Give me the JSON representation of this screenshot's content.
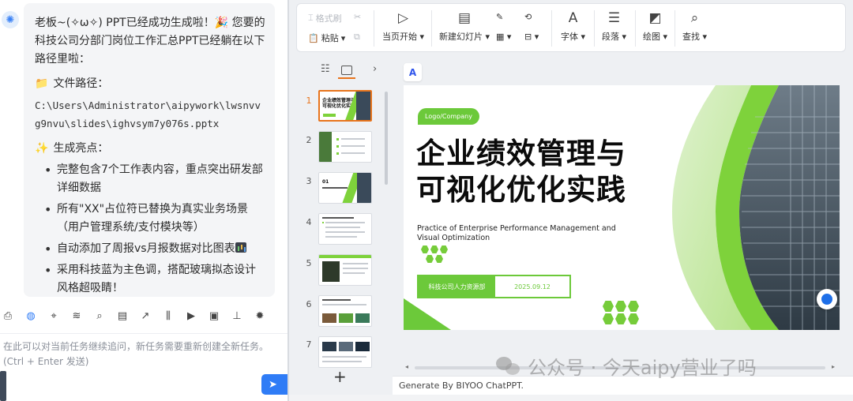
{
  "chat": {
    "greeting": "老板~(✧ω✧) PPT已经成功生成啦！🎉 您要的科技公司分部门岗位工作汇总PPT已经躺在以下路径里啦：",
    "file_path_label": "文件路径：",
    "file_path": "C:\\Users\\Administrator\\aipywork\\lwsnvvg9nvu\\slides\\ighvsym7y076s.pptx",
    "highlights_label": "生成亮点：",
    "highlights": [
      "完整包含7个工作表内容，重点突出研发部详细数据",
      "所有\"XX\"占位符已替换为真实业务场景（用户管理系统/支付模块等）",
      "自动添加了周报vs月报数据对比图表",
      "采用科技蓝为主色调，搭配玻璃拟态设计风格超吸睛！"
    ],
    "input_placeholder_1": "在此可以对当前任务继续追问，新任务需要重新创建全新任务。",
    "input_placeholder_2": "(Ctrl + Enter 发送)",
    "send_label": "发"
  },
  "ribbon": {
    "format_painter": "格式刷",
    "paste": "粘贴",
    "play_from_current": "当页开始",
    "new_slide": "新建幻灯片",
    "font": "字体",
    "paragraph": "段落",
    "drawing": "绘图",
    "find": "查找"
  },
  "thumbnails": {
    "numbers": [
      "1",
      "2",
      "3",
      "4",
      "5",
      "6",
      "7"
    ],
    "active_index": 1,
    "add_label": "+"
  },
  "slide": {
    "logo": "Logo/Company",
    "title_line1": "企业绩效管理与",
    "title_line2": "可视化优化实践",
    "subtitle": "Practice of Enterprise Performance Management and Visual Optimization",
    "org": "科技公司人力资源部",
    "date": "2025.09.12"
  },
  "notes": {
    "generator": "Generate By BIYOO ChatPPT."
  },
  "watermark": {
    "text": "公众号 · 今天aipy营业了吗"
  },
  "colors": {
    "accent_green": "#6cc93a",
    "active_orange": "#e8741c",
    "send_blue": "#2f7cf6"
  }
}
